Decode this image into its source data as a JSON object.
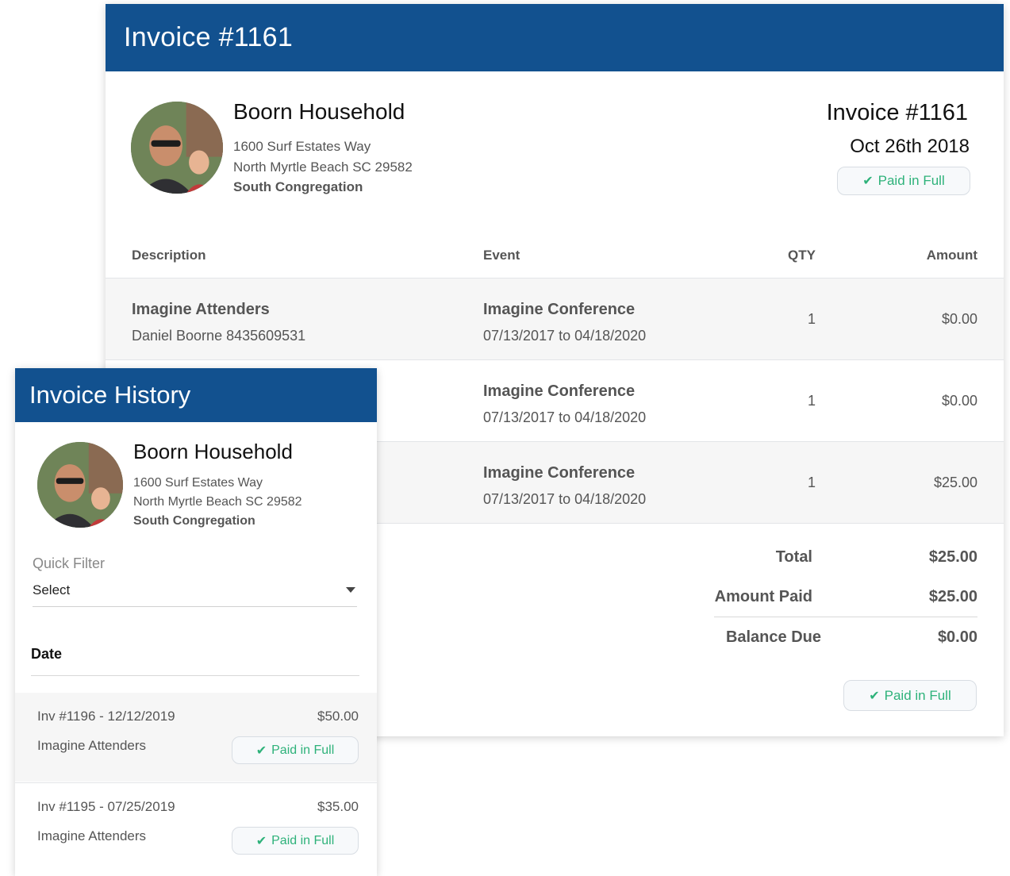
{
  "invoice": {
    "header_title": "Invoice #1161",
    "household": {
      "name": "Boorn Household",
      "address1": "1600 Surf Estates Way",
      "address2": "North Myrtle Beach SC 29582",
      "congregation": "South Congregation"
    },
    "number": "Invoice #1161",
    "date": "Oct 26th 2018",
    "status": "Paid in Full",
    "columns": {
      "description": "Description",
      "event": "Event",
      "qty": "QTY",
      "amount": "Amount"
    },
    "rows": [
      {
        "description": "Imagine Attenders",
        "sub": "Daniel Boorne 8435609531",
        "event": "Imagine Conference",
        "dates": "07/13/2017 to 04/18/2020",
        "qty": "1",
        "amount": "$0.00"
      },
      {
        "description": "",
        "sub": "",
        "event": "Imagine Conference",
        "dates": "07/13/2017 to 04/18/2020",
        "qty": "1",
        "amount": "$0.00"
      },
      {
        "description": "",
        "sub": "",
        "event": "Imagine Conference",
        "dates": "07/13/2017 to 04/18/2020",
        "qty": "1",
        "amount": "$25.00"
      }
    ],
    "totals": {
      "total_label": "Total",
      "total_value": "$25.00",
      "paid_label": "Amount Paid",
      "paid_value": "$25.00",
      "balance_label": "Balance Due",
      "balance_value": "$0.00"
    },
    "footer_status": "Paid in Full"
  },
  "history": {
    "header_title": "Invoice History",
    "household": {
      "name": "Boorn Household",
      "address1": "1600 Surf Estates Way",
      "address2": "North Myrtle Beach SC 29582",
      "congregation": "South Congregation"
    },
    "filter_label": "Quick Filter",
    "filter_value": "Select",
    "date_heading": "Date",
    "items": [
      {
        "invoice": "Inv #1196 - 12/12/2019",
        "amount": "$50.00",
        "description": "Imagine Attenders",
        "status": "Paid in Full"
      },
      {
        "invoice": "Inv #1195 - 07/25/2019",
        "amount": "$35.00",
        "description": "Imagine Attenders",
        "status": "Paid in Full"
      }
    ]
  },
  "colors": {
    "header_blue": "#12518f",
    "paid_green": "#2eb27a",
    "row_shade": "#f6f6f6"
  },
  "icons": {
    "check": "check-icon",
    "caret": "caret-down-icon",
    "avatar": "avatar-photo"
  }
}
